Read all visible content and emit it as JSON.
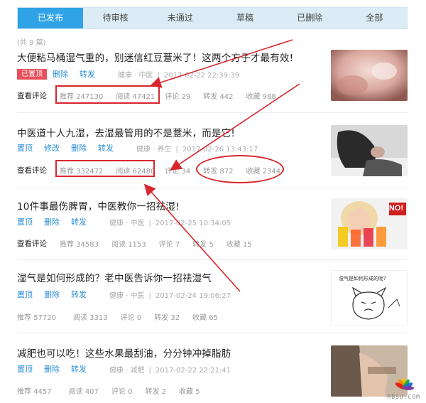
{
  "tabs": [
    {
      "label": "已发布",
      "active": true
    },
    {
      "label": "待审核"
    },
    {
      "label": "未通过"
    },
    {
      "label": "草稿"
    },
    {
      "label": "已删除"
    },
    {
      "label": "全部"
    }
  ],
  "count_label": "(共 9 篇)",
  "actions": {
    "pinned": "已置顶",
    "pin": "置顶",
    "edit": "修改",
    "delete": "删除",
    "forward": "转发",
    "view_comments": "查看评论"
  },
  "articles": [
    {
      "title": "大便粘马桶湿气重的，别迷信红豆薏米了！这两个方子才最有效!",
      "meta_category": "健康 · 中医",
      "meta_date": "2017-02-22 22:39:39",
      "recommend": "推荐 247130",
      "reads": "阅读 47421",
      "comments": "评论 29",
      "forwards": "转发 442",
      "favorites": "收藏 988"
    },
    {
      "title": "中医道十人九湿，去湿最管用的不是薏米，而是它!",
      "meta_category": "健康 · 养生",
      "meta_date": "2017-02-26 13:43:17",
      "recommend": "推荐 332472",
      "reads": "阅读 62480",
      "comments": "评论 34",
      "forwards": "转发 872",
      "favorites": "收藏 2344"
    },
    {
      "title": "10件事最伤脾胃，中医教你一招祛湿!",
      "meta_category": "健康 · 中医",
      "meta_date": "2017-02-25 10:34:05",
      "recommend": "推荐 34583",
      "reads": "阅读 1153",
      "comments": "评论 7",
      "forwards": "转发 5",
      "favorites": "收藏 15"
    },
    {
      "title": "湿气是如何形成的？老中医告诉你一招祛湿气",
      "meta_category": "健康 · 中医",
      "meta_date": "2017-02-24 19:06:27",
      "recommend": "推荐 57720",
      "reads": "阅读 3313",
      "comments": "评论 0",
      "forwards": "转发 32",
      "favorites": "收藏 65"
    },
    {
      "title": "减肥也可以吃！这些水果最刮油，分分钟冲掉脂肪",
      "meta_category": "健康 · 减肥",
      "meta_date": "2017-02-22 22:21:41",
      "recommend": "推荐 4457",
      "reads": "阅读 407",
      "comments": "评论 0",
      "forwards": "转发 2",
      "favorites": "收藏 5"
    }
  ],
  "thumb3_text": "NO!",
  "thumb4_caption": "湿气是如何形成的呢?",
  "watermark": "MBSU.COM",
  "colors": {
    "tab_active": "#2fa3e6",
    "tab_bar": "#dcecf6",
    "link": "#2b8fd8",
    "annotation": "#d8262d",
    "pinned_badge": "#e8505b"
  }
}
